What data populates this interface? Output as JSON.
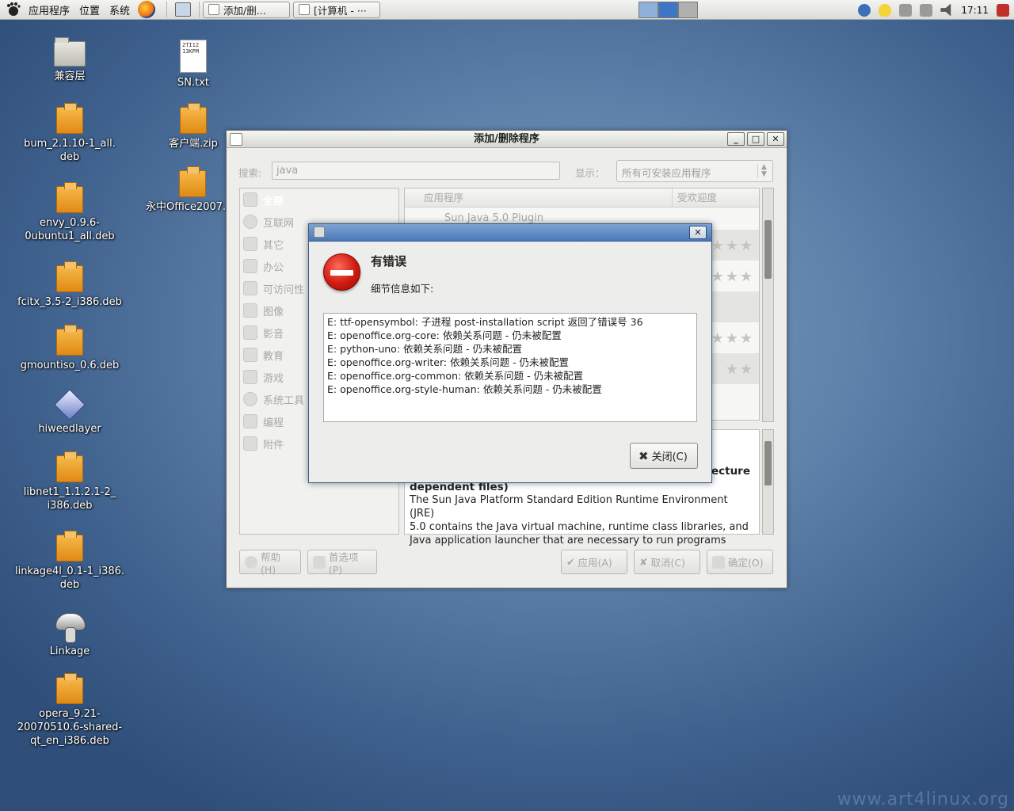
{
  "panel": {
    "menus": [
      {
        "label": "应用程序"
      },
      {
        "label": "位置"
      },
      {
        "label": "系统"
      }
    ],
    "tasks": [
      {
        "label": "添加/删..."
      },
      {
        "label": "[计算机 - ···"
      }
    ],
    "clock": "17:11"
  },
  "desktop": {
    "icons": [
      {
        "label": "兼容层",
        "type": "folder"
      },
      {
        "label": "bum_2.1.10-1_all.\ndeb",
        "type": "package"
      },
      {
        "label": "envy_0.9.6-\n0ubuntu1_all.deb",
        "type": "package"
      },
      {
        "label": "fcitx_3.5-2_i386.deb",
        "type": "package"
      },
      {
        "label": "gmountiso_0.6.deb",
        "type": "package"
      },
      {
        "label": "hiweedlayer",
        "type": "app"
      },
      {
        "label": "libnet1_1.1.2.1-2_\ni386.deb",
        "type": "package"
      },
      {
        "label": "linkage4l_0.1-1_i386.\ndeb",
        "type": "package"
      },
      {
        "label": "Linkage",
        "type": "app"
      },
      {
        "label": "opera_9.21-\n20070510.6-shared-\nqt_en_i386.deb",
        "type": "package"
      },
      {
        "label": "SN.txt",
        "type": "text",
        "preview": "2TI12\n13KPM"
      },
      {
        "label": "客户端.zip",
        "type": "package"
      },
      {
        "label": "永中Office2007.",
        "type": "package"
      }
    ],
    "watermark": "www.art4linux.org"
  },
  "main_window": {
    "title": "添加/删除程序",
    "search_label": "搜索:",
    "search_value": "java",
    "show_label": "显示：",
    "show_value": "所有可安装应用程序",
    "categories": [
      {
        "label": "全部",
        "selected": true
      },
      {
        "label": "互联网"
      },
      {
        "label": "其它"
      },
      {
        "label": "办公"
      },
      {
        "label": "可访问性"
      },
      {
        "label": "图像"
      },
      {
        "label": "影音"
      },
      {
        "label": "教育"
      },
      {
        "label": "游戏"
      },
      {
        "label": "系统工具"
      },
      {
        "label": "编程"
      },
      {
        "label": "附件"
      }
    ],
    "columns": {
      "app": "应用程序",
      "popularity": "受欢迎度"
    },
    "first_row": "Sun Java 5.0 Plugin",
    "desc_title_right": "ecture",
    "desc_title_left": "dependent files)",
    "description": "The Sun Java Platform Standard Edition Runtime Environment (JRE)\n5.0 contains the Java virtual machine, runtime class libraries, and\nJava application launcher that are necessary to run programs",
    "buttons": {
      "help": "帮助(H)",
      "prefs": "首选项(P)",
      "apply": "应用(A)",
      "cancel": "取消(C)",
      "ok": "确定(O)"
    }
  },
  "error_dialog": {
    "heading": "有错误",
    "subheading": "细节信息如下:",
    "details": "E: ttf-opensymbol: 子进程 post-installation script 返回了错误号 36\nE: openoffice.org-core: 依赖关系问题 - 仍未被配置\nE: python-uno: 依赖关系问题 - 仍未被配置\nE: openoffice.org-writer: 依赖关系问题 - 仍未被配置\nE: openoffice.org-common: 依赖关系问题 - 仍未被配置\nE: openoffice.org-style-human: 依赖关系问题 - 仍未被配置",
    "close_label": "关闭(C)"
  }
}
